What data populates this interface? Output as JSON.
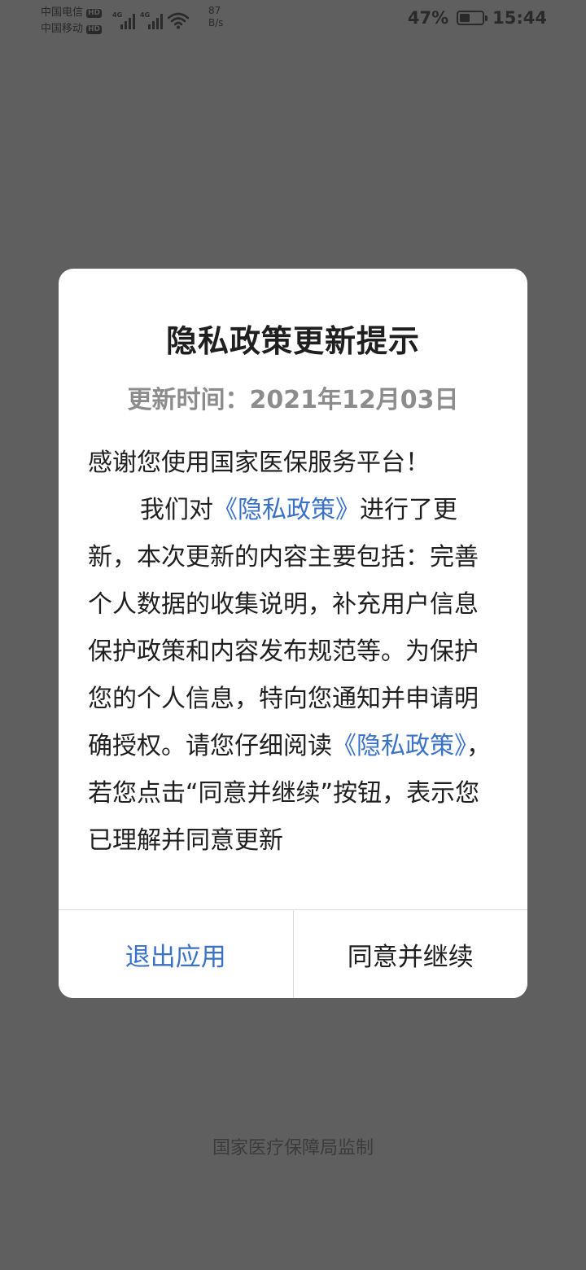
{
  "status_bar": {
    "carrier_1": "中国电信",
    "carrier_2": "中国移动",
    "hd_label": "HD",
    "network_type": "4G",
    "net_speed_value": "87",
    "net_speed_unit": "B/s",
    "battery_percent": "47%",
    "battery_level": 0.47,
    "time": "15:44"
  },
  "dialog": {
    "title": "隐私政策更新提示",
    "update_time": "更新时间：2021年12月03日",
    "greeting": "感谢您使用国家医保服务平台！",
    "para_intro": "我们对",
    "policy_link_1": "《隐私政策》",
    "para_middle": "进行了更新，本次更新的内容主要包括：完善个人数据的收集说明，补充用户信息保护政策和内容发布规范等。为保护您的个人信息，特向您通知并申请明确授权。请您仔细阅读",
    "policy_link_2": "《隐私政策》",
    "para_end": "，若您点击“同意并继续”按钮，表示您已理解并同意更新",
    "exit_button": "退出应用",
    "agree_button": "同意并继续"
  },
  "footer": {
    "supervision": "国家医疗保障局监制"
  },
  "colors": {
    "overlay": "#5f5f5f",
    "link": "#3a72c8",
    "text": "#1f1f1f",
    "muted": "#8c8c8c"
  }
}
